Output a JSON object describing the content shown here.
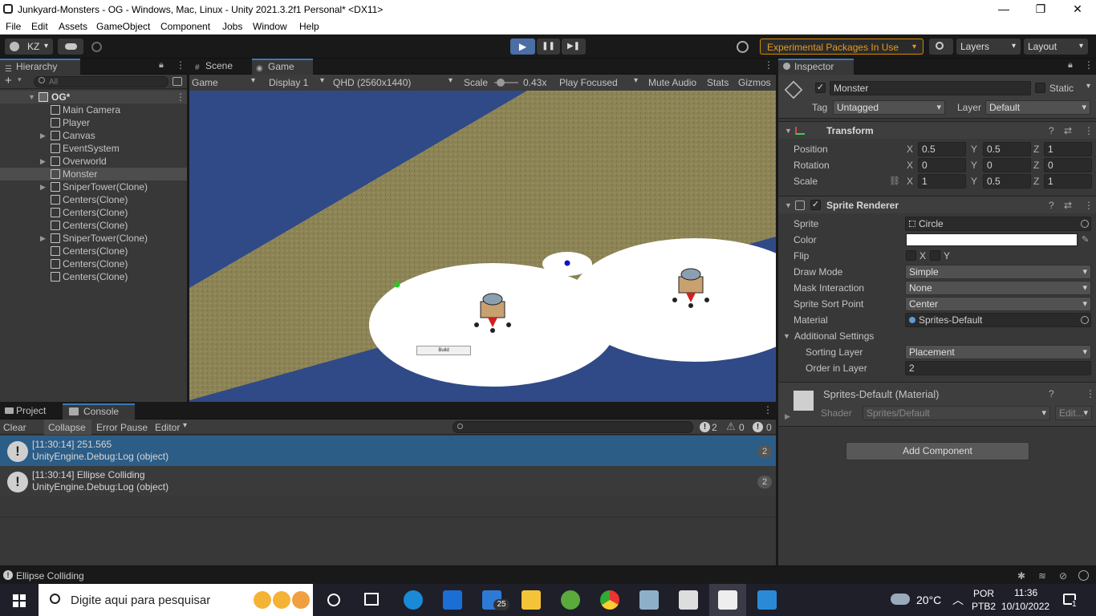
{
  "window": {
    "title": "Junkyard-Monsters - OG - Windows, Mac, Linux - Unity 2021.3.2f1 Personal* <DX11>",
    "minimize": "—",
    "restore": "❐",
    "close": "✕"
  },
  "menu": [
    "File",
    "Edit",
    "Assets",
    "GameObject",
    "Component",
    "Jobs",
    "Window",
    "Help"
  ],
  "toolbar": {
    "account": "KZ",
    "play": "▶",
    "pause": "❚❚",
    "step": "▶❚",
    "experimental": "Experimental Packages In Use",
    "layers": "Layers",
    "layout": "Layout"
  },
  "hierarchy": {
    "tab": "Hierarchy",
    "search_placeholder": "All",
    "add": "+",
    "scene": "OG*",
    "items": [
      {
        "label": "Main Camera",
        "expandable": false
      },
      {
        "label": "Player",
        "expandable": false
      },
      {
        "label": "Canvas",
        "expandable": true
      },
      {
        "label": "EventSystem",
        "expandable": false
      },
      {
        "label": "Overworld",
        "expandable": true
      },
      {
        "label": "Monster",
        "expandable": false,
        "selected": true
      },
      {
        "label": "SniperTower(Clone)",
        "expandable": true
      },
      {
        "label": "Centers(Clone)",
        "expandable": false
      },
      {
        "label": "Centers(Clone)",
        "expandable": false
      },
      {
        "label": "Centers(Clone)",
        "expandable": false
      },
      {
        "label": "SniperTower(Clone)",
        "expandable": true
      },
      {
        "label": "Centers(Clone)",
        "expandable": false
      },
      {
        "label": "Centers(Clone)",
        "expandable": false
      },
      {
        "label": "Centers(Clone)",
        "expandable": false
      }
    ]
  },
  "game": {
    "tab_scene": "Scene",
    "tab_game": "Game",
    "mode": "Game",
    "display": "Display 1",
    "resolution": "QHD (2560x1440)",
    "scale_label": "Scale",
    "scale_value": "0.43x",
    "play_focused": "Play Focused",
    "mute": "Mute Audio",
    "stats": "Stats",
    "gizmos": "Gizmos",
    "build_button": "Build",
    "colors": {
      "water": "#2f4a86",
      "sand": "#8d8456",
      "circle": "#ffffff"
    }
  },
  "console": {
    "tab_project": "Project",
    "tab_console": "Console",
    "clear": "Clear",
    "collapse": "Collapse",
    "error_pause": "Error Pause",
    "editor": "Editor",
    "count_log": "2",
    "count_warn": "0",
    "count_err": "0",
    "rows": [
      {
        "line1": "[11:30:14] 251.565",
        "line2": "UnityEngine.Debug:Log (object)",
        "count": "2",
        "selected": true
      },
      {
        "line1": "[11:30:14] Ellipse Colliding",
        "line2": "UnityEngine.Debug:Log (object)",
        "count": "2",
        "selected": false
      }
    ]
  },
  "inspector": {
    "tab": "Inspector",
    "object_name": "Monster",
    "static_label": "Static",
    "tag_label": "Tag",
    "tag_value": "Untagged",
    "layer_label": "Layer",
    "layer_value": "Default",
    "transform": {
      "title": "Transform",
      "position": {
        "label": "Position",
        "x": "0.5",
        "y": "0.5",
        "z": "1"
      },
      "rotation": {
        "label": "Rotation",
        "x": "0",
        "y": "0",
        "z": "0"
      },
      "scale": {
        "label": "Scale",
        "x": "1",
        "y": "0.5",
        "z": "1"
      }
    },
    "sprite_renderer": {
      "title": "Sprite Renderer",
      "sprite_label": "Sprite",
      "sprite_value": "Circle",
      "color_label": "Color",
      "flip_label": "Flip",
      "flip_x": "X",
      "flip_y": "Y",
      "draw_mode_label": "Draw Mode",
      "draw_mode_value": "Simple",
      "mask_label": "Mask Interaction",
      "mask_value": "None",
      "sort_point_label": "Sprite Sort Point",
      "sort_point_value": "Center",
      "material_label": "Material",
      "material_value": "Sprites-Default",
      "additional_label": "Additional Settings",
      "sorting_layer_label": "Sorting Layer",
      "sorting_layer_value": "Placement",
      "order_label": "Order in Layer",
      "order_value": "2"
    },
    "material": {
      "name": "Sprites-Default (Material)",
      "shader_label": "Shader",
      "shader_value": "Sprites/Default",
      "edit": "Edit..."
    },
    "add_component": "Add Component"
  },
  "status": {
    "message": "Ellipse Colliding"
  },
  "taskbar": {
    "search_placeholder": "Digite aqui para pesquisar",
    "mail_badge": "25",
    "temperature": "20°C",
    "lang1": "POR",
    "lang2": "PTB2",
    "time": "11:36",
    "date": "10/10/2022",
    "notif": "1"
  }
}
